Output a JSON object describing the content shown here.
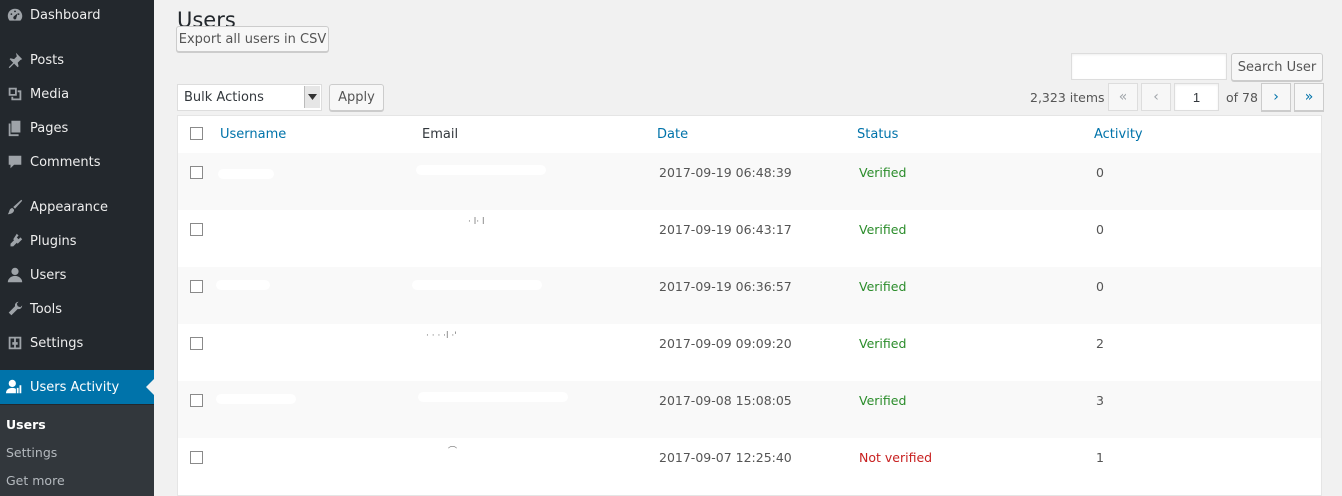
{
  "sidebar": {
    "items": [
      {
        "label": "Dashboard",
        "icon": "dashboard-icon"
      },
      {
        "label": "Posts",
        "icon": "pin-icon"
      },
      {
        "label": "Media",
        "icon": "media-icon"
      },
      {
        "label": "Pages",
        "icon": "pages-icon"
      },
      {
        "label": "Comments",
        "icon": "comment-icon"
      },
      {
        "label": "Appearance",
        "icon": "brush-icon"
      },
      {
        "label": "Plugins",
        "icon": "plugin-icon"
      },
      {
        "label": "Users",
        "icon": "user-icon"
      },
      {
        "label": "Tools",
        "icon": "wrench-icon"
      },
      {
        "label": "Settings",
        "icon": "settings-icon"
      },
      {
        "label": "Users Activity",
        "icon": "users-activity-icon"
      }
    ],
    "submenu": [
      {
        "label": "Users"
      },
      {
        "label": "Settings"
      },
      {
        "label": "Get more"
      }
    ]
  },
  "page": {
    "title": "Users",
    "export_label": "Export all users in CSV",
    "search_value": "",
    "search_label": "Search User",
    "bulk_actions": "Bulk Actions",
    "apply_label": "Apply",
    "items_count": "2,323 items",
    "current_page": "1",
    "of_total": "of 78"
  },
  "pagination": {
    "first": "«",
    "prev": "‹",
    "next": "›",
    "last": "»"
  },
  "table": {
    "columns": [
      "Username",
      "Email",
      "Date",
      "Status",
      "Activity"
    ],
    "rows": [
      {
        "date": "2017-09-19 06:48:39",
        "status": "Verified",
        "activity": "0"
      },
      {
        "date": "2017-09-19 06:43:17",
        "status": "Verified",
        "activity": "0"
      },
      {
        "date": "2017-09-19 06:36:57",
        "status": "Verified",
        "activity": "0"
      },
      {
        "date": "2017-09-09 09:09:20",
        "status": "Verified",
        "activity": "2"
      },
      {
        "date": "2017-09-08 15:08:05",
        "status": "Verified",
        "activity": "3"
      },
      {
        "date": "2017-09-07 12:25:40",
        "status": "Not verified",
        "activity": "1"
      }
    ]
  },
  "colors": {
    "sidebar_bg": "#23282d",
    "accent": "#0073aa",
    "verified": "#2a8c2a",
    "not_verified": "#c82020"
  }
}
